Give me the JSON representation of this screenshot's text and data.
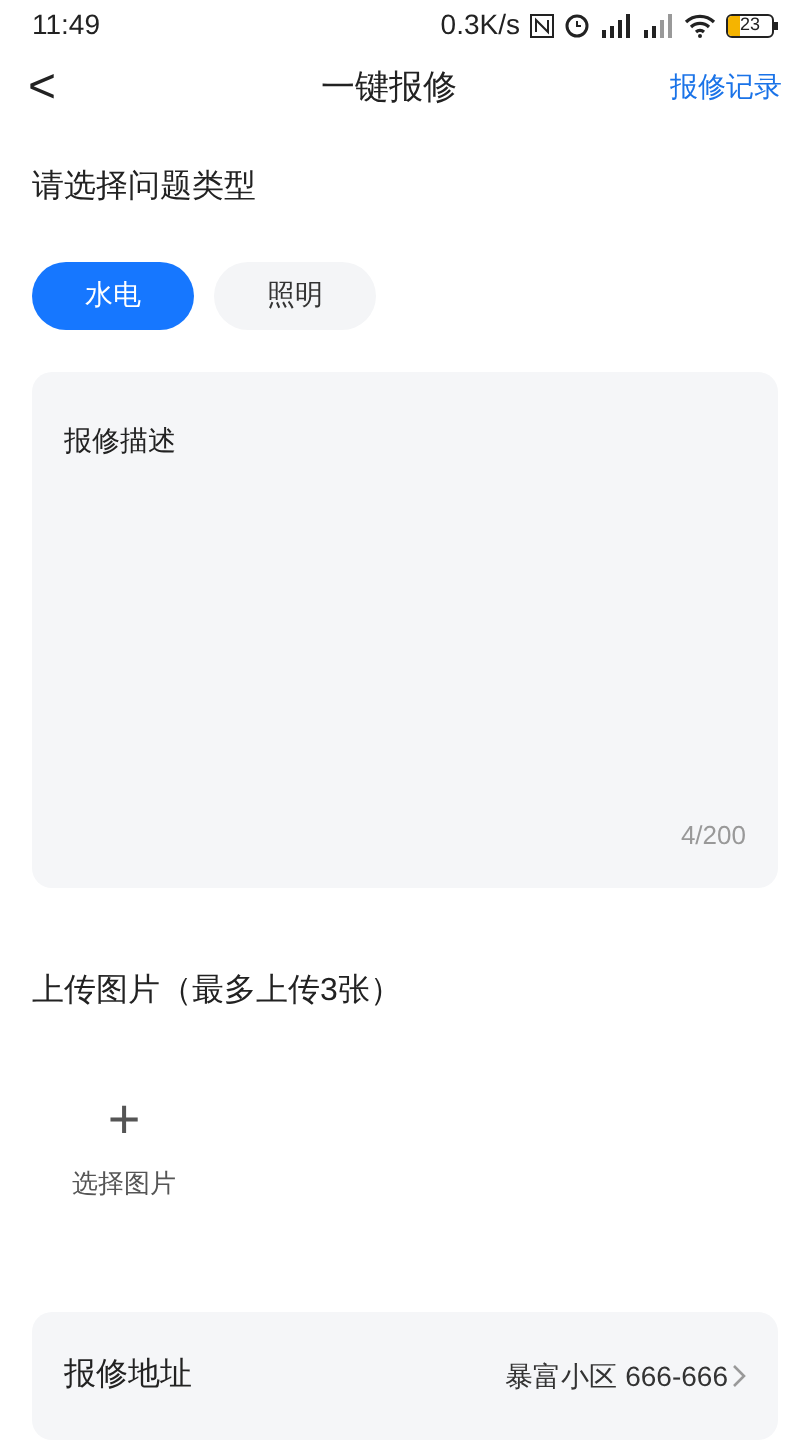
{
  "status_bar": {
    "time": "11:49",
    "speed": "0.3K/s",
    "battery": "23"
  },
  "nav": {
    "back": "<",
    "title": "一键报修",
    "action": "报修记录"
  },
  "section_title": "请选择问题类型",
  "types": [
    {
      "label": "水电",
      "selected": true
    },
    {
      "label": "照明",
      "selected": false
    }
  ],
  "description": {
    "value": "报修描述",
    "counter": "4/200"
  },
  "upload": {
    "title": "上传图片（最多上传3张）",
    "plus": "+",
    "label": "选择图片"
  },
  "address": {
    "label": "报修地址",
    "value": "暴富小区 666-666"
  }
}
